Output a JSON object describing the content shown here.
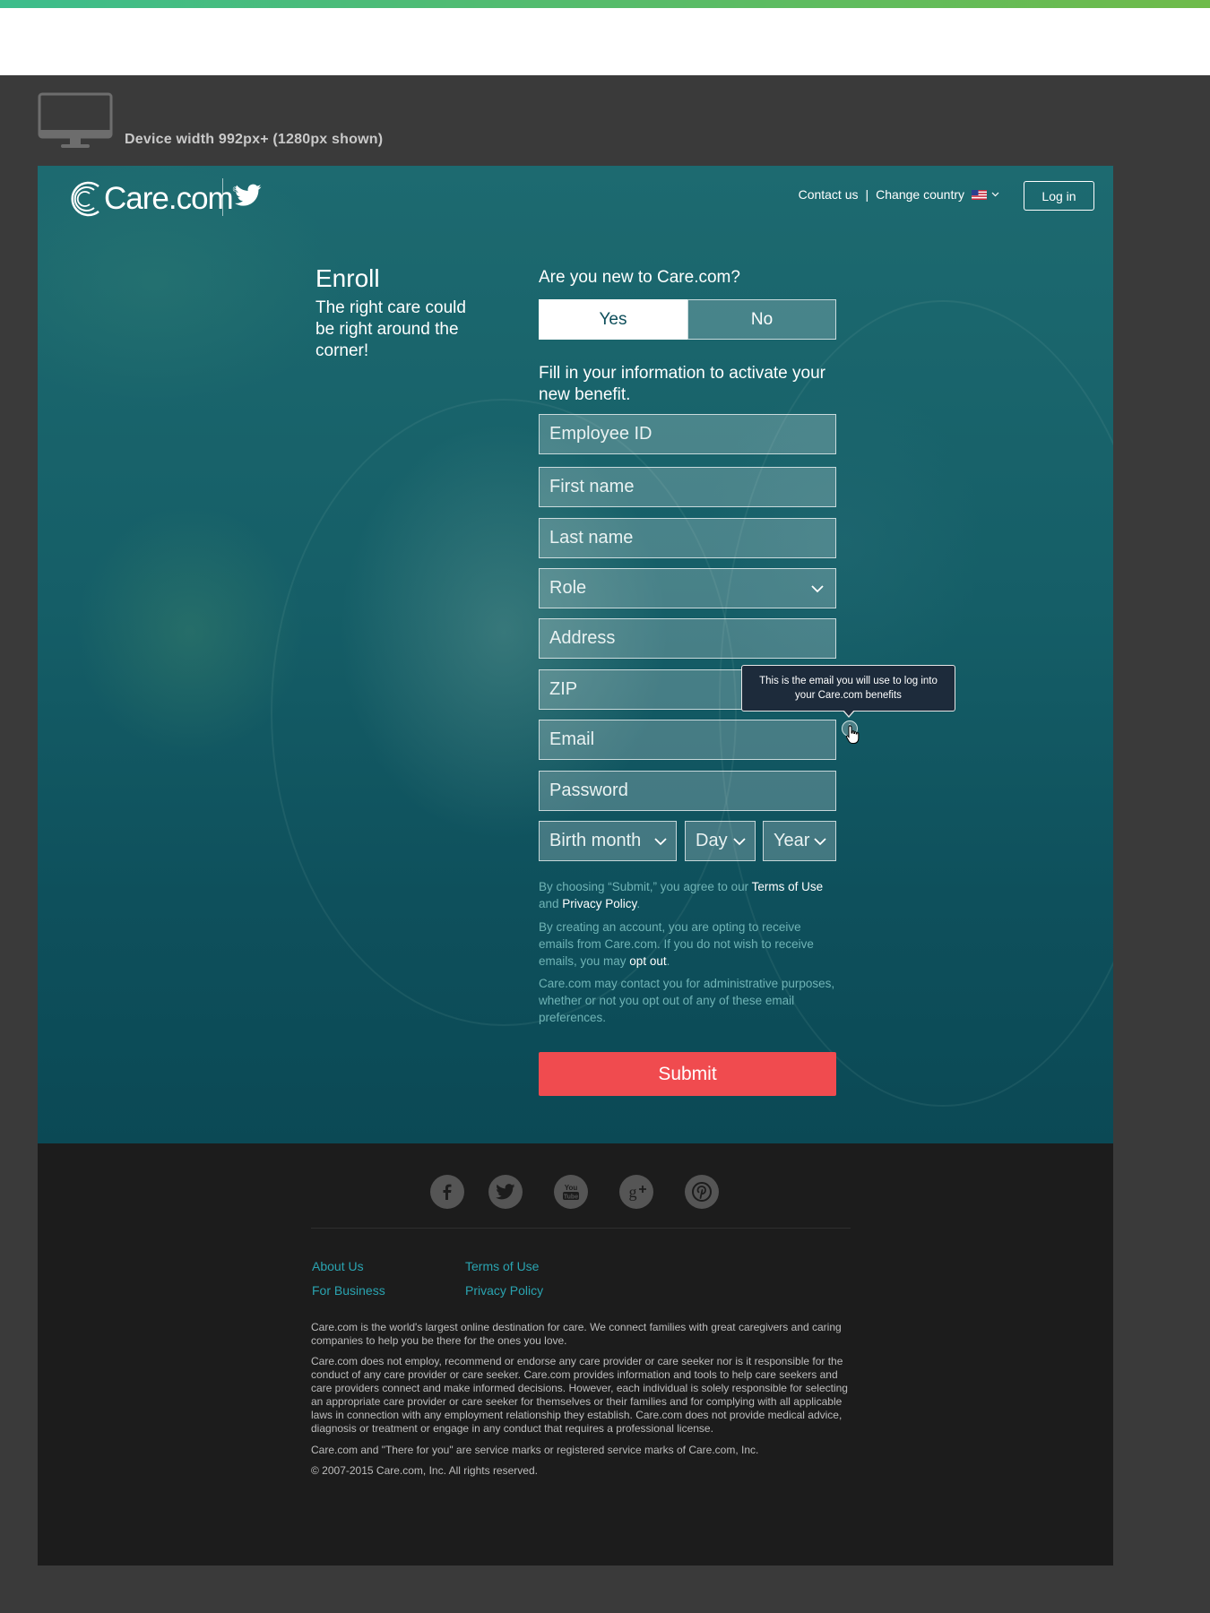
{
  "device": {
    "caption": "Device width 992px+ (1280px shown)"
  },
  "header": {
    "logo_text": "Care.com",
    "logo_tm": "®",
    "contact_label": "Contact us",
    "separator": "|",
    "country_label": "Change country",
    "login_label": "Log in"
  },
  "enroll": {
    "title": "Enroll",
    "subtitle": "The right care could be right around the corner!"
  },
  "form": {
    "question": "Are you new to Care.com?",
    "yes_label": "Yes",
    "no_label": "No",
    "fill_text": "Fill in your information to activate your new benefit.",
    "employee_id": "Employee ID",
    "first_name": "First name",
    "last_name": "Last name",
    "role": "Role",
    "address": "Address",
    "zip": "ZIP",
    "email": "Email",
    "password": "Password",
    "birth_month": "Birth month",
    "day": "Day",
    "year": "Year",
    "tooltip": "This is the email you will use to log into your Care.com benefits",
    "info_icon": "i",
    "legal1_pre": "By choosing “Submit,” you agree to our ",
    "legal1_terms": "Terms of Use",
    "legal1_and": " and ",
    "legal1_privacy": "Privacy Policy",
    "legal1_end": ".",
    "legal2_pre": "By creating an account, you are opting to receive emails from Care.com. If you do not wish to receive emails, you may ",
    "legal2_optout": "opt out",
    "legal2_end": ".",
    "legal3": "Care.com may contact you for administrative purposes, whether or not you opt out of any of these email preferences.",
    "submit_label": "Submit"
  },
  "footer": {
    "social": [
      "facebook-icon",
      "twitter-icon",
      "youtube-icon",
      "google-plus-icon",
      "pinterest-icon"
    ],
    "links": {
      "about": "About Us",
      "business": "For Business",
      "terms": "Terms of Use",
      "privacy": "Privacy Policy"
    },
    "para1": "Care.com is the world's largest online destination for care. We connect families with great caregivers and caring companies to help you be there for the ones you love.",
    "para2": "Care.com does not employ, recommend or endorse any care provider or care seeker nor is it responsible for the conduct of any care provider or care seeker. Care.com provides information and tools to help care seekers and care providers connect and make informed decisions. However, each individual is solely responsible for selecting an appropriate care provider or care seeker for themselves or their families and for complying with all applicable laws in connection with any employment relationship they establish. Care.com does not provide medical advice, diagnosis or treatment or engage in any conduct that requires a professional license.",
    "para3": "Care.com and \"There for you\" are service marks or registered service marks of Care.com, Inc.",
    "copyright": "© 2007-2015 Care.com, Inc. All rights reserved."
  },
  "colors": {
    "accent_green": "#6fbb4a",
    "hero_teal": "#0d4e5a",
    "submit_red": "#f04b4f",
    "footer_link": "#2aa3b0"
  }
}
